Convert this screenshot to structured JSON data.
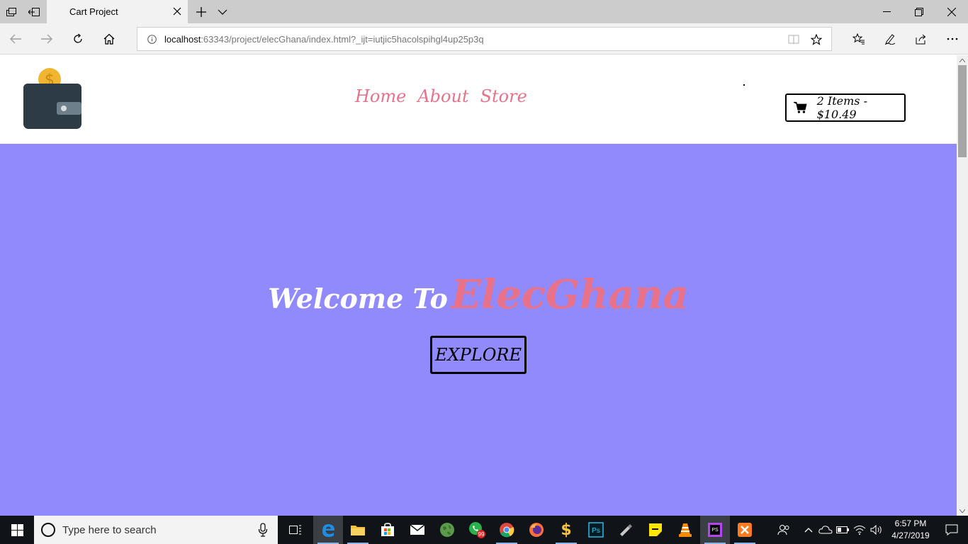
{
  "browser": {
    "tab_title": "Cart Project",
    "url_host": "localhost",
    "url_rest": ":63343/project/elecGhana/index.html?_ijt=iutjic5hacolspihgl4up25p3q"
  },
  "site": {
    "nav": [
      "Home",
      "About",
      "Store"
    ],
    "cart_text": "2 Items - $10.49",
    "welcome_prefix": "Welcome To",
    "brand": "ElecGhana",
    "explore_label": "EXPLORE"
  },
  "colors": {
    "hero_bg": "#918afc",
    "accent_pink": "#e8728a"
  },
  "taskbar": {
    "search_placeholder": "Type here to search",
    "whatsapp_badge": "99",
    "time": "6:57 PM",
    "date": "4/27/2019"
  }
}
